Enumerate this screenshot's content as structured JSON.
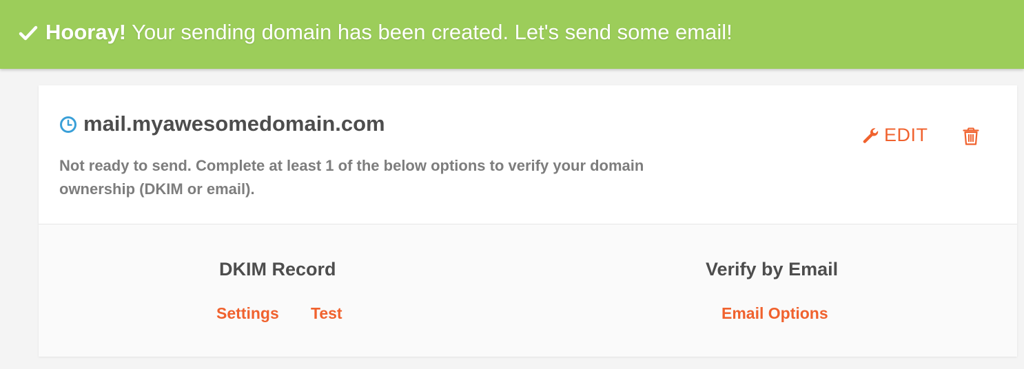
{
  "banner": {
    "icon": "check-icon",
    "strong": "Hooray!",
    "message": "Your sending domain has been created. Let's send some email!",
    "color": "#9ccd5a"
  },
  "domain": {
    "status_icon": "clock-icon",
    "name": "mail.myawesomedomain.com",
    "status_text": "Not ready to send. Complete at least 1 of the below options to verify your domain ownership (DKIM or email).",
    "edit_label": "EDIT",
    "edit_icon": "wrench-icon",
    "delete_icon": "trash-icon"
  },
  "verification": {
    "dkim": {
      "title": "DKIM Record",
      "settings_label": "Settings",
      "test_label": "Test"
    },
    "email": {
      "title": "Verify by Email",
      "options_label": "Email Options"
    }
  },
  "colors": {
    "accent": "#f0622e",
    "clock": "#3aa0d8",
    "text_dark": "#4d4d4d",
    "text_muted": "#7d7d7d"
  }
}
